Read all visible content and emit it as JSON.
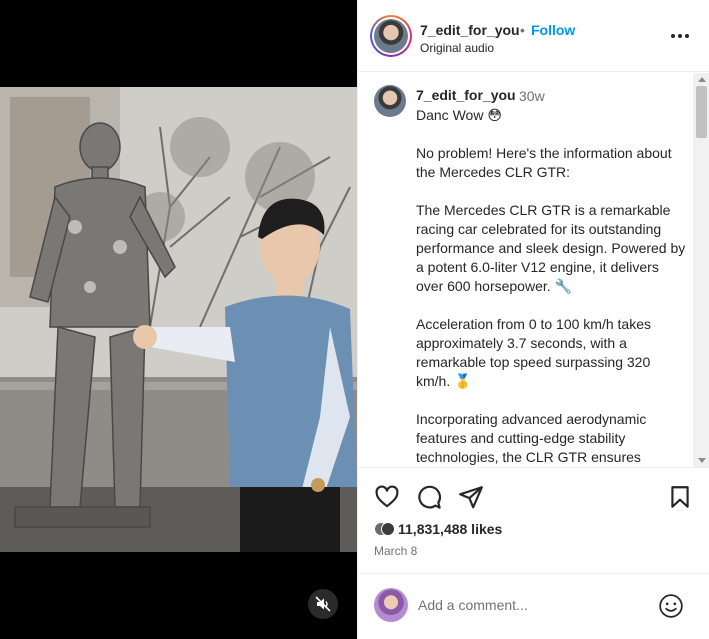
{
  "header": {
    "username": "7_edit_for_you",
    "separator": "•",
    "follow_label": "Follow",
    "audio": "Original audio",
    "more_icon": "more-horizontal-icon"
  },
  "caption": {
    "username": "7_edit_for_you",
    "time": "30w",
    "paragraphs": [
      "Danc Wow 😳",
      "No problem! Here's the information about the Mercedes CLR GTR:",
      "The Mercedes CLR GTR is a remarkable racing car celebrated for its outstanding performance and sleek design. Powered by a potent 6.0-liter V12 engine, it delivers over 600 horsepower. 🔧",
      "Acceleration from 0 to 100 km/h takes approximately 3.7 seconds, with a remarkable top speed surpassing 320 km/h. 🥇",
      "Incorporating advanced aerodynamic features and cutting-edge stability technologies, the CLR GTR ensures"
    ]
  },
  "actions": {
    "like_icon": "heart-icon",
    "comment_icon": "comment-icon",
    "share_icon": "share-icon",
    "save_icon": "bookmark-icon"
  },
  "likes": {
    "count": "11,831,488 likes"
  },
  "date": "March 8",
  "add_comment": {
    "placeholder": "Add a comment...",
    "emoji_icon": "emoji-icon"
  },
  "video": {
    "mute_icon": "muted-speaker-icon"
  },
  "colors": {
    "accent": "#0095f6",
    "text": "#262626",
    "secondary": "#737373"
  }
}
